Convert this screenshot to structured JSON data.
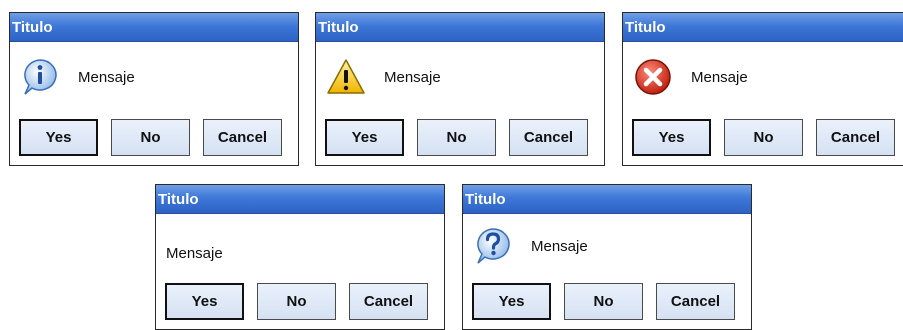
{
  "dialogs": [
    {
      "title": "Titulo",
      "message": "Mensaje",
      "icon": "info-icon",
      "buttons": {
        "yes": "Yes",
        "no": "No",
        "cancel": "Cancel"
      }
    },
    {
      "title": "Titulo",
      "message": "Mensaje",
      "icon": "warning-icon",
      "buttons": {
        "yes": "Yes",
        "no": "No",
        "cancel": "Cancel"
      }
    },
    {
      "title": "Titulo",
      "message": "Mensaje",
      "icon": "error-icon",
      "buttons": {
        "yes": "Yes",
        "no": "No",
        "cancel": "Cancel"
      }
    },
    {
      "title": "Titulo",
      "message": "Mensaje",
      "icon": "",
      "buttons": {
        "yes": "Yes",
        "no": "No",
        "cancel": "Cancel"
      }
    },
    {
      "title": "Titulo",
      "message": "Mensaje",
      "icon": "question-icon",
      "buttons": {
        "yes": "Yes",
        "no": "No",
        "cancel": "Cancel"
      }
    }
  ],
  "colors": {
    "titlebar_top": "#6f9ee6",
    "titlebar_bottom": "#2d63c4",
    "button_face": "#d5e1f3"
  }
}
